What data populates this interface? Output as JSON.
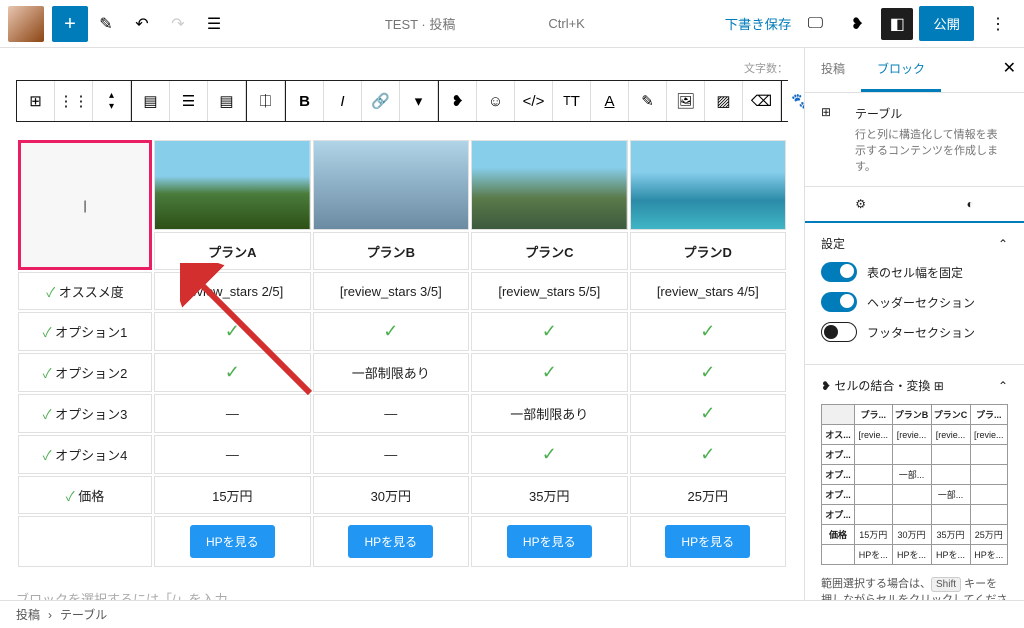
{
  "header": {
    "title": "TEST · 投稿",
    "shortcut": "Ctrl+K",
    "draft_save": "下書き保存",
    "publish": "公開"
  },
  "wordcount_label": "文字数：",
  "table": {
    "plans": [
      "プランA",
      "プランB",
      "プランC",
      "プランD"
    ],
    "rows": [
      {
        "label": "オススメ度",
        "cells": [
          "[review_stars 2/5]",
          "[review_stars 3/5]",
          "[review_stars 5/5]",
          "[review_stars 4/5]"
        ]
      },
      {
        "label": "オプション1",
        "cells": [
          "check",
          "check",
          "check",
          "check"
        ]
      },
      {
        "label": "オプション2",
        "cells": [
          "check",
          "一部制限あり",
          "check",
          "check"
        ]
      },
      {
        "label": "オプション3",
        "cells": [
          "—",
          "—",
          "一部制限あり",
          "check"
        ]
      },
      {
        "label": "オプション4",
        "cells": [
          "—",
          "—",
          "check",
          "check"
        ]
      },
      {
        "label": "価格",
        "cells": [
          "15万円",
          "30万円",
          "35万円",
          "25万円"
        ]
      }
    ],
    "buttons": [
      "HPを見る",
      "HPを見る",
      "HPを見る",
      "HPを見る"
    ]
  },
  "placeholder": "ブロックを選択するには「/」を入力",
  "chart_data": {
    "type": "table",
    "columns": [
      "",
      "プランA",
      "プランB",
      "プランC",
      "プランD"
    ],
    "rows": [
      [
        "オススメ度",
        "2/5",
        "3/5",
        "5/5",
        "4/5"
      ],
      [
        "オプション1",
        "yes",
        "yes",
        "yes",
        "yes"
      ],
      [
        "オプション2",
        "yes",
        "一部制限あり",
        "yes",
        "yes"
      ],
      [
        "オプション3",
        "no",
        "no",
        "一部制限あり",
        "yes"
      ],
      [
        "オプション4",
        "no",
        "no",
        "yes",
        "yes"
      ],
      [
        "価格",
        "15万円",
        "30万円",
        "35万円",
        "25万円"
      ]
    ]
  },
  "sidebar": {
    "tab_post": "投稿",
    "tab_block": "ブロック",
    "block_name": "テーブル",
    "block_desc": "行と列に構造化して情報を表示するコンテンツを作成します。",
    "settings_label": "設定",
    "toggle_fixed": "表のセル幅を固定",
    "toggle_header": "ヘッダーセクション",
    "toggle_footer": "フッターセクション",
    "merge_label": "セルの結合・変換",
    "mini": {
      "headers": [
        "",
        "プラ...",
        "プランB",
        "プランC",
        "プラ..."
      ],
      "rows": [
        [
          "オス...",
          "[revie...",
          "[revie...",
          "[revie...",
          "[revie..."
        ],
        [
          "オプ...",
          "",
          "",
          "",
          ""
        ],
        [
          "オプ...",
          "",
          "一部...",
          "",
          ""
        ],
        [
          "オプ...",
          "",
          "",
          "一部...",
          ""
        ],
        [
          "オプ...",
          "",
          "",
          "",
          ""
        ],
        [
          "価格",
          "15万円",
          "30万円",
          "35万円",
          "25万円"
        ],
        [
          "",
          "HPを...",
          "HPを...",
          "HPを...",
          "HPを..."
        ]
      ]
    },
    "hint_pre": "範囲選択する場合は、",
    "hint_key": "Shift",
    "hint_post": "キーを押しながらセルをクリックしてください。"
  },
  "breadcrumb": {
    "post": "投稿",
    "block": "テーブル"
  }
}
